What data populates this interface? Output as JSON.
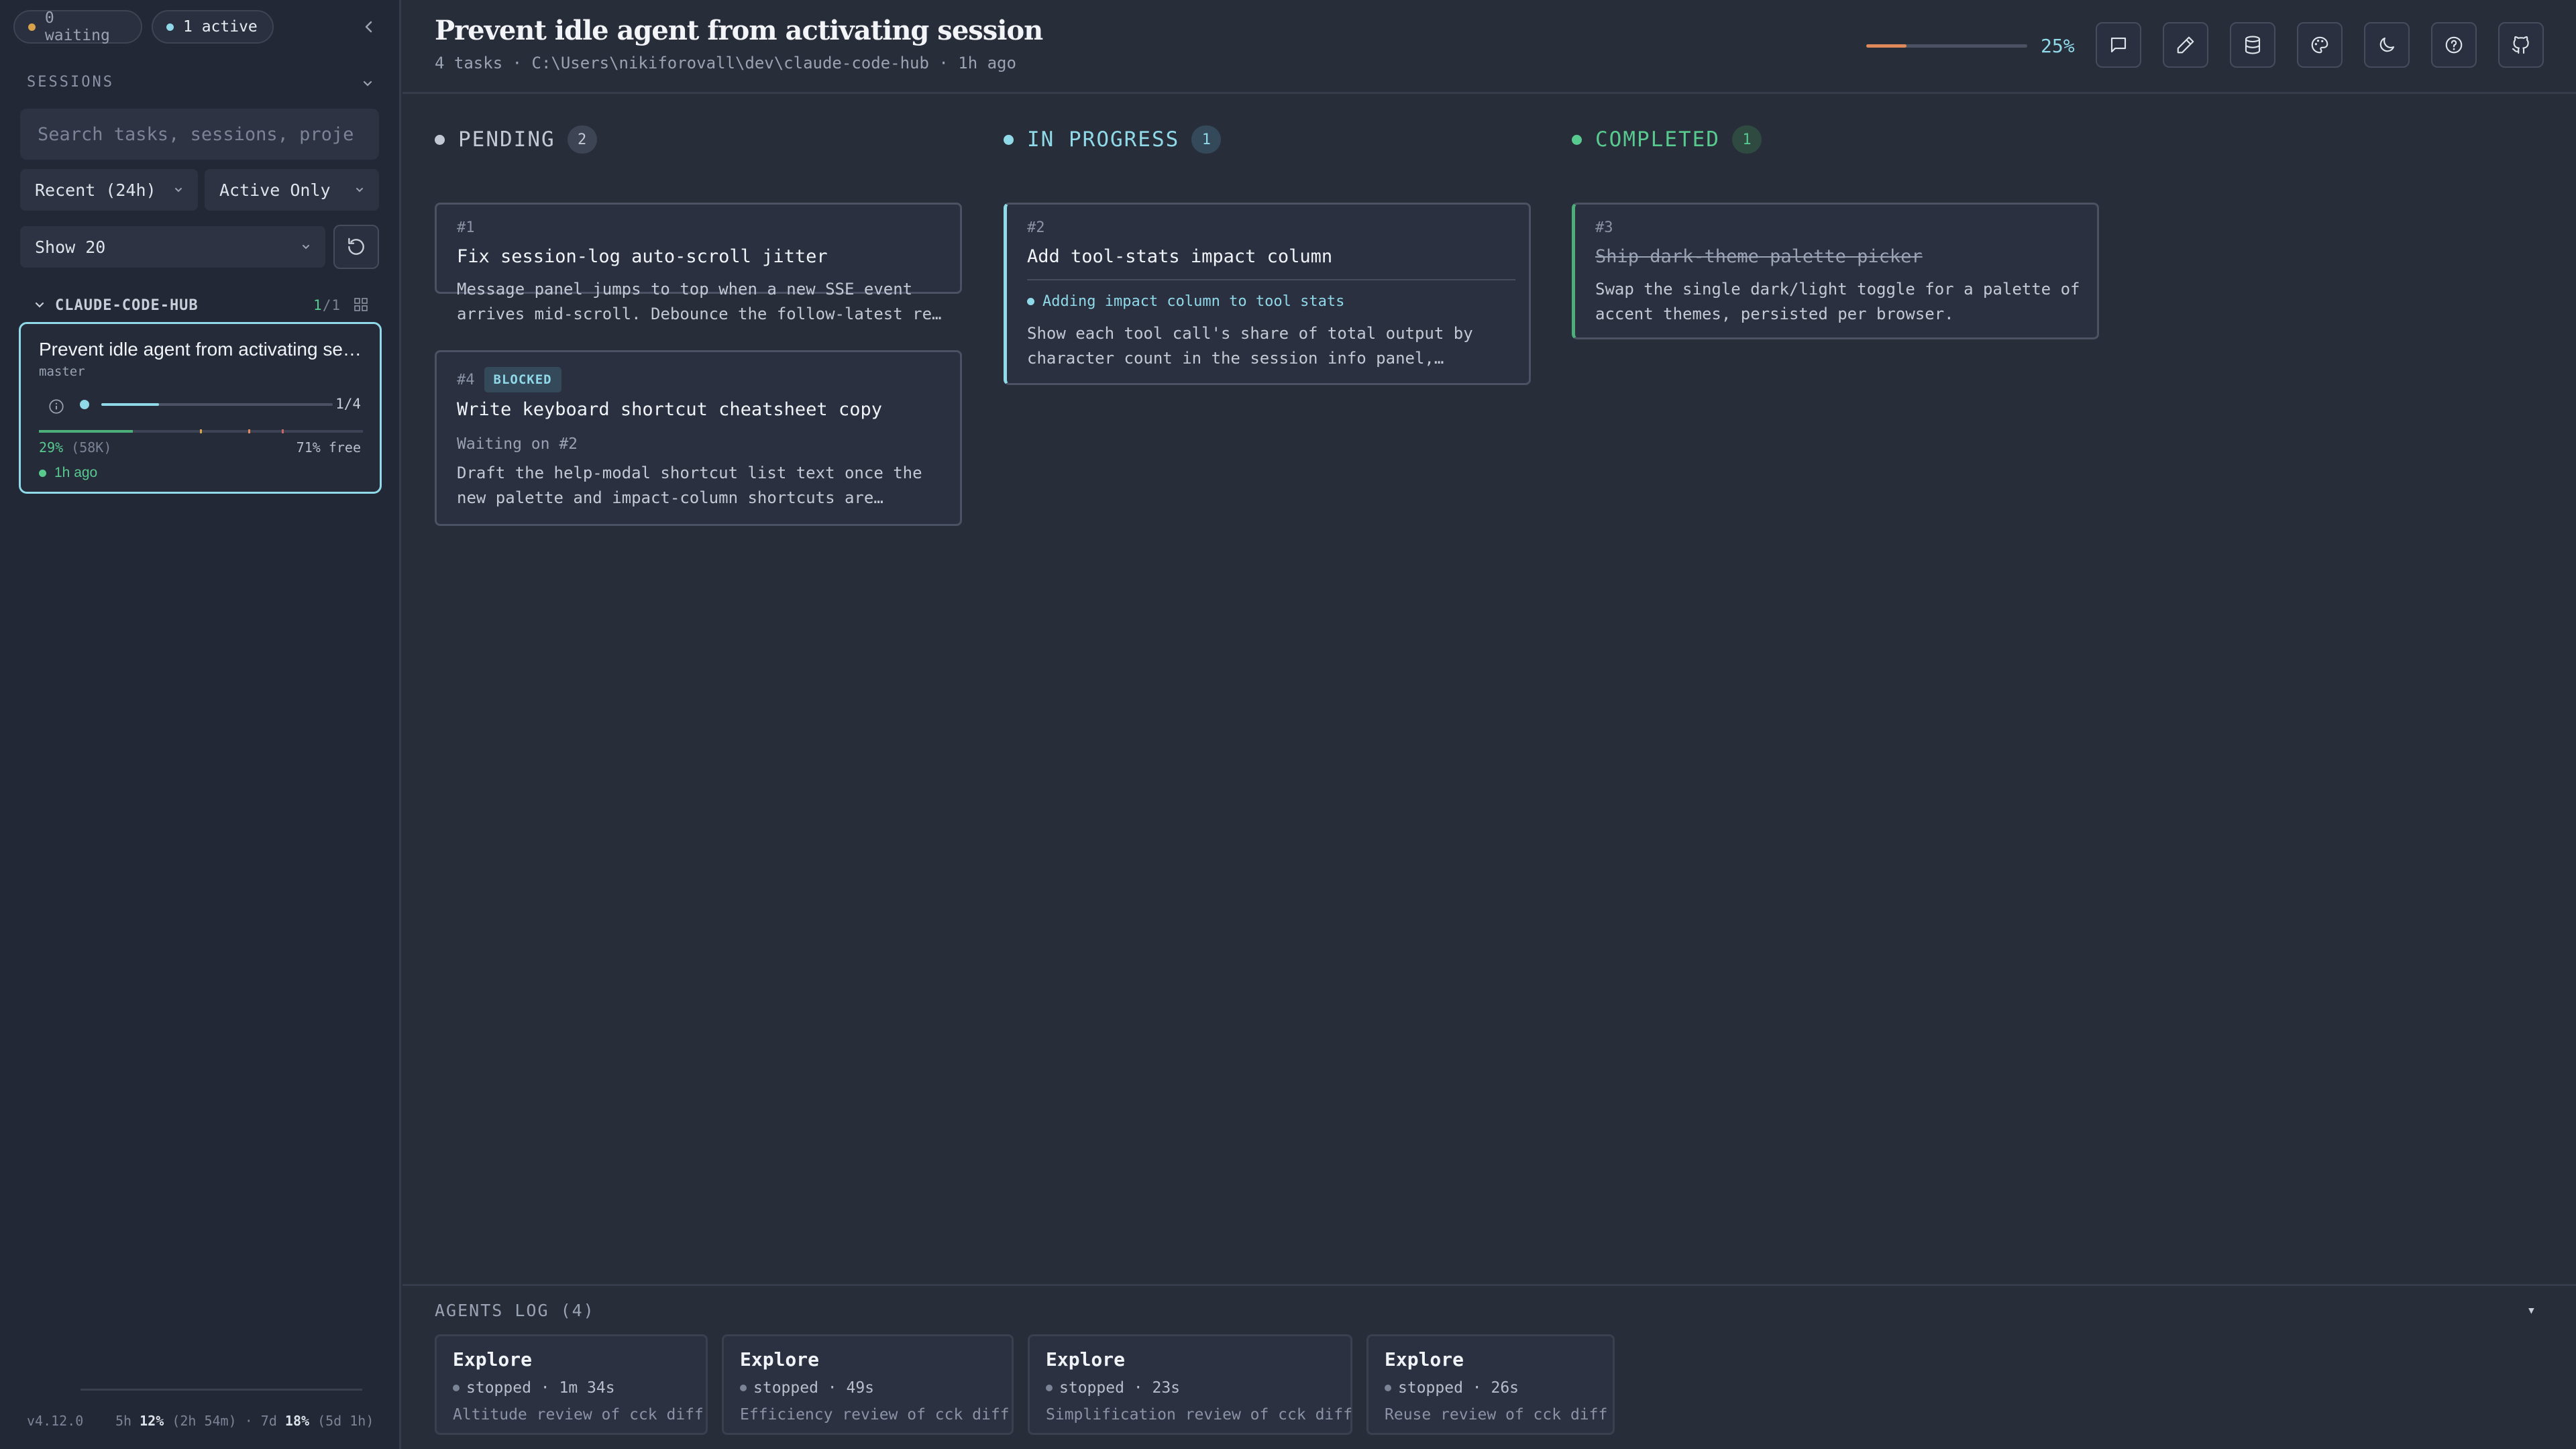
{
  "sidebar": {
    "pills": {
      "waiting": "0 waiting",
      "active": "1 active"
    },
    "sessions_label": "SESSIONS",
    "search_placeholder": "Search tasks, sessions, proje",
    "filters": {
      "time": "Recent (24h)",
      "status": "Active Only",
      "show": "Show 20"
    },
    "project": {
      "name": "CLAUDE-CODE-HUB",
      "count_active": "1",
      "count_sep": "/",
      "count_total": "1"
    },
    "session_card": {
      "title": "Prevent idle agent from activating session",
      "branch": "master",
      "progress_fraction": 0.25,
      "progress_text": "1/4",
      "context_used_fraction": 0.29,
      "context_pct": "29%",
      "context_tokens": "(58K)",
      "context_free": "71% free",
      "time": "1h ago"
    },
    "footer": {
      "version": "v4.12.0",
      "usage_5h_label": "5h",
      "usage_5h_pct": "12%",
      "usage_5h_reset": "(2h 54m)",
      "usage_sep": "·",
      "usage_7d_label": "7d",
      "usage_7d_pct": "18%",
      "usage_7d_reset": "(5d 1h)"
    }
  },
  "header": {
    "title": "Prevent idle agent from activating session",
    "meta": "4 tasks · C:\\Users\\nikiforovall\\dev\\claude-code-hub · 1h ago",
    "progress_fraction": 0.25,
    "progress_pct": "25%",
    "buttons": [
      "message-icon",
      "pencil-icon",
      "database-icon",
      "palette-icon",
      "moon-icon",
      "help-icon",
      "github-icon"
    ]
  },
  "columns": {
    "pending": {
      "label": "PENDING",
      "count": "2",
      "color": "#9aa3b3",
      "cards": [
        {
          "id": "#1",
          "title": "Fix session-log auto-scroll jitter",
          "desc": "Message panel jumps to top when a new SSE event arrives mid-scroll. Debounce the follow-latest re…"
        },
        {
          "id": "#4",
          "badge": "BLOCKED",
          "title": "Write keyboard shortcut cheatsheet copy",
          "waiting": "Waiting on #2",
          "desc": "Draft the help-modal shortcut list text once the new palette and impact-column shortcuts are…"
        }
      ]
    },
    "in_progress": {
      "label": "IN PROGRESS",
      "count": "1",
      "color": "#8fd9e8",
      "cards": [
        {
          "id": "#2",
          "title": "Add tool-stats impact column",
          "activity": "Adding impact column to tool stats",
          "desc": "Show each tool call's share of total output by character count in the session info panel,…"
        }
      ]
    },
    "completed": {
      "label": "COMPLETED",
      "count": "1",
      "color": "#58c98f",
      "cards": [
        {
          "id": "#3",
          "title": "Ship dark-theme palette picker",
          "desc": "Swap the single dark/light toggle for a palette of accent themes, persisted per browser."
        }
      ]
    }
  },
  "agents_log": {
    "title": "AGENTS LOG (4)",
    "toggle": "▾",
    "agents": [
      {
        "name": "Explore",
        "status": "stopped · 1m 34s",
        "desc": "Altitude review of cck diff"
      },
      {
        "name": "Explore",
        "status": "stopped · 49s",
        "desc": "Efficiency review of cck diff"
      },
      {
        "name": "Explore",
        "status": "stopped · 23s",
        "desc": "Simplification review of cck diff"
      },
      {
        "name": "Explore",
        "status": "stopped · 26s",
        "desc": "Reuse review of cck diff"
      }
    ]
  }
}
